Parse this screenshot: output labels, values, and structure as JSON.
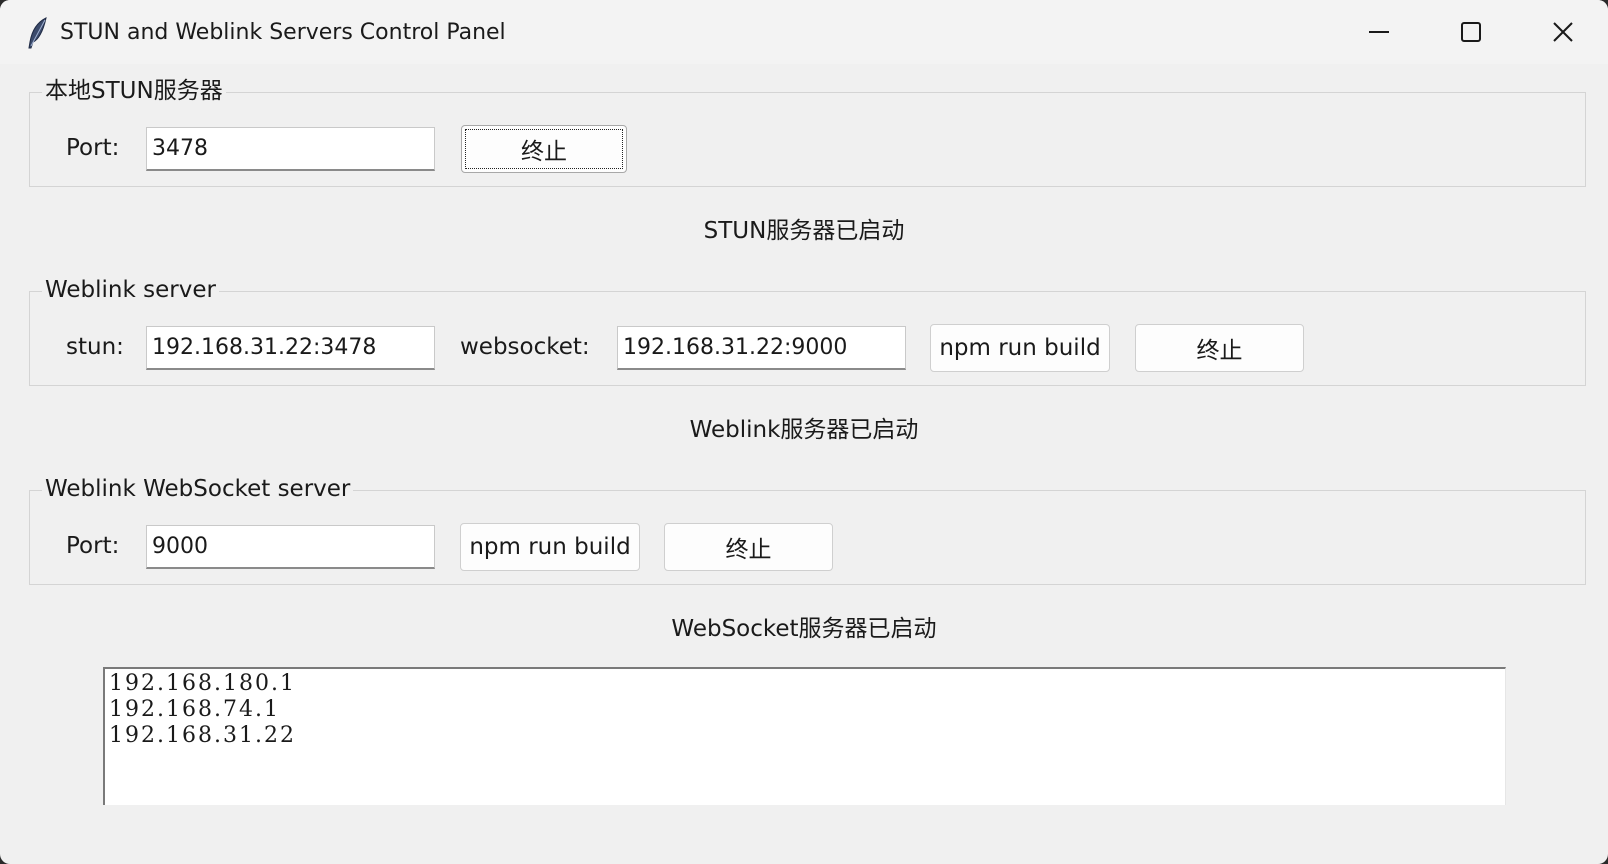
{
  "window": {
    "title": "STUN and Weblink Servers Control Panel"
  },
  "stun_group": {
    "label": "本地STUN服务器",
    "port_label": "Port:",
    "port_value": "3478",
    "stop_button": "终止"
  },
  "stun_status": "STUN服务器已启动",
  "weblink_group": {
    "label": "Weblink server",
    "stun_label": "stun:",
    "stun_value": "192.168.31.22:3478",
    "websocket_label": "websocket:",
    "websocket_value": "192.168.31.22:9000",
    "build_button": "npm run build",
    "stop_button": "终止"
  },
  "weblink_status": "Weblink服务器已启动",
  "websocket_group": {
    "label": "Weblink WebSocket server",
    "port_label": "Port:",
    "port_value": "9000",
    "build_button": "npm run build",
    "stop_button": "终止"
  },
  "websocket_status": "WebSocket服务器已启动",
  "ip_list": [
    "192.168.180.1",
    "192.168.74.1",
    "192.168.31.22"
  ]
}
